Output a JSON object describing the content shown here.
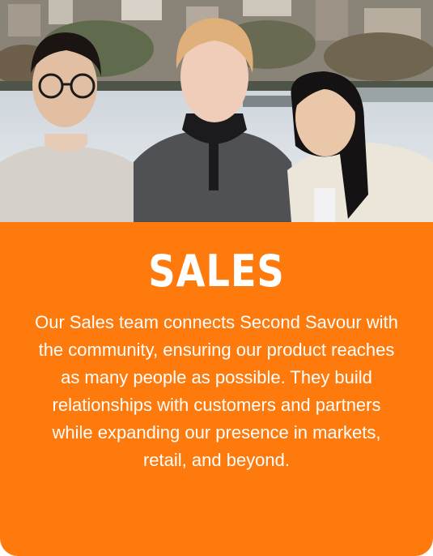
{
  "team_card": {
    "title": "SALES",
    "description": "Our Sales team connects Second Savour with the community, ensuring our product reaches as many people as possible. They build relationships with customers and partners while expanding our presence in markets, retail, and beyond.",
    "photo_icon": "team-photo",
    "colors": {
      "background": "#FF7A0D",
      "text": "#FFFFFF"
    }
  }
}
